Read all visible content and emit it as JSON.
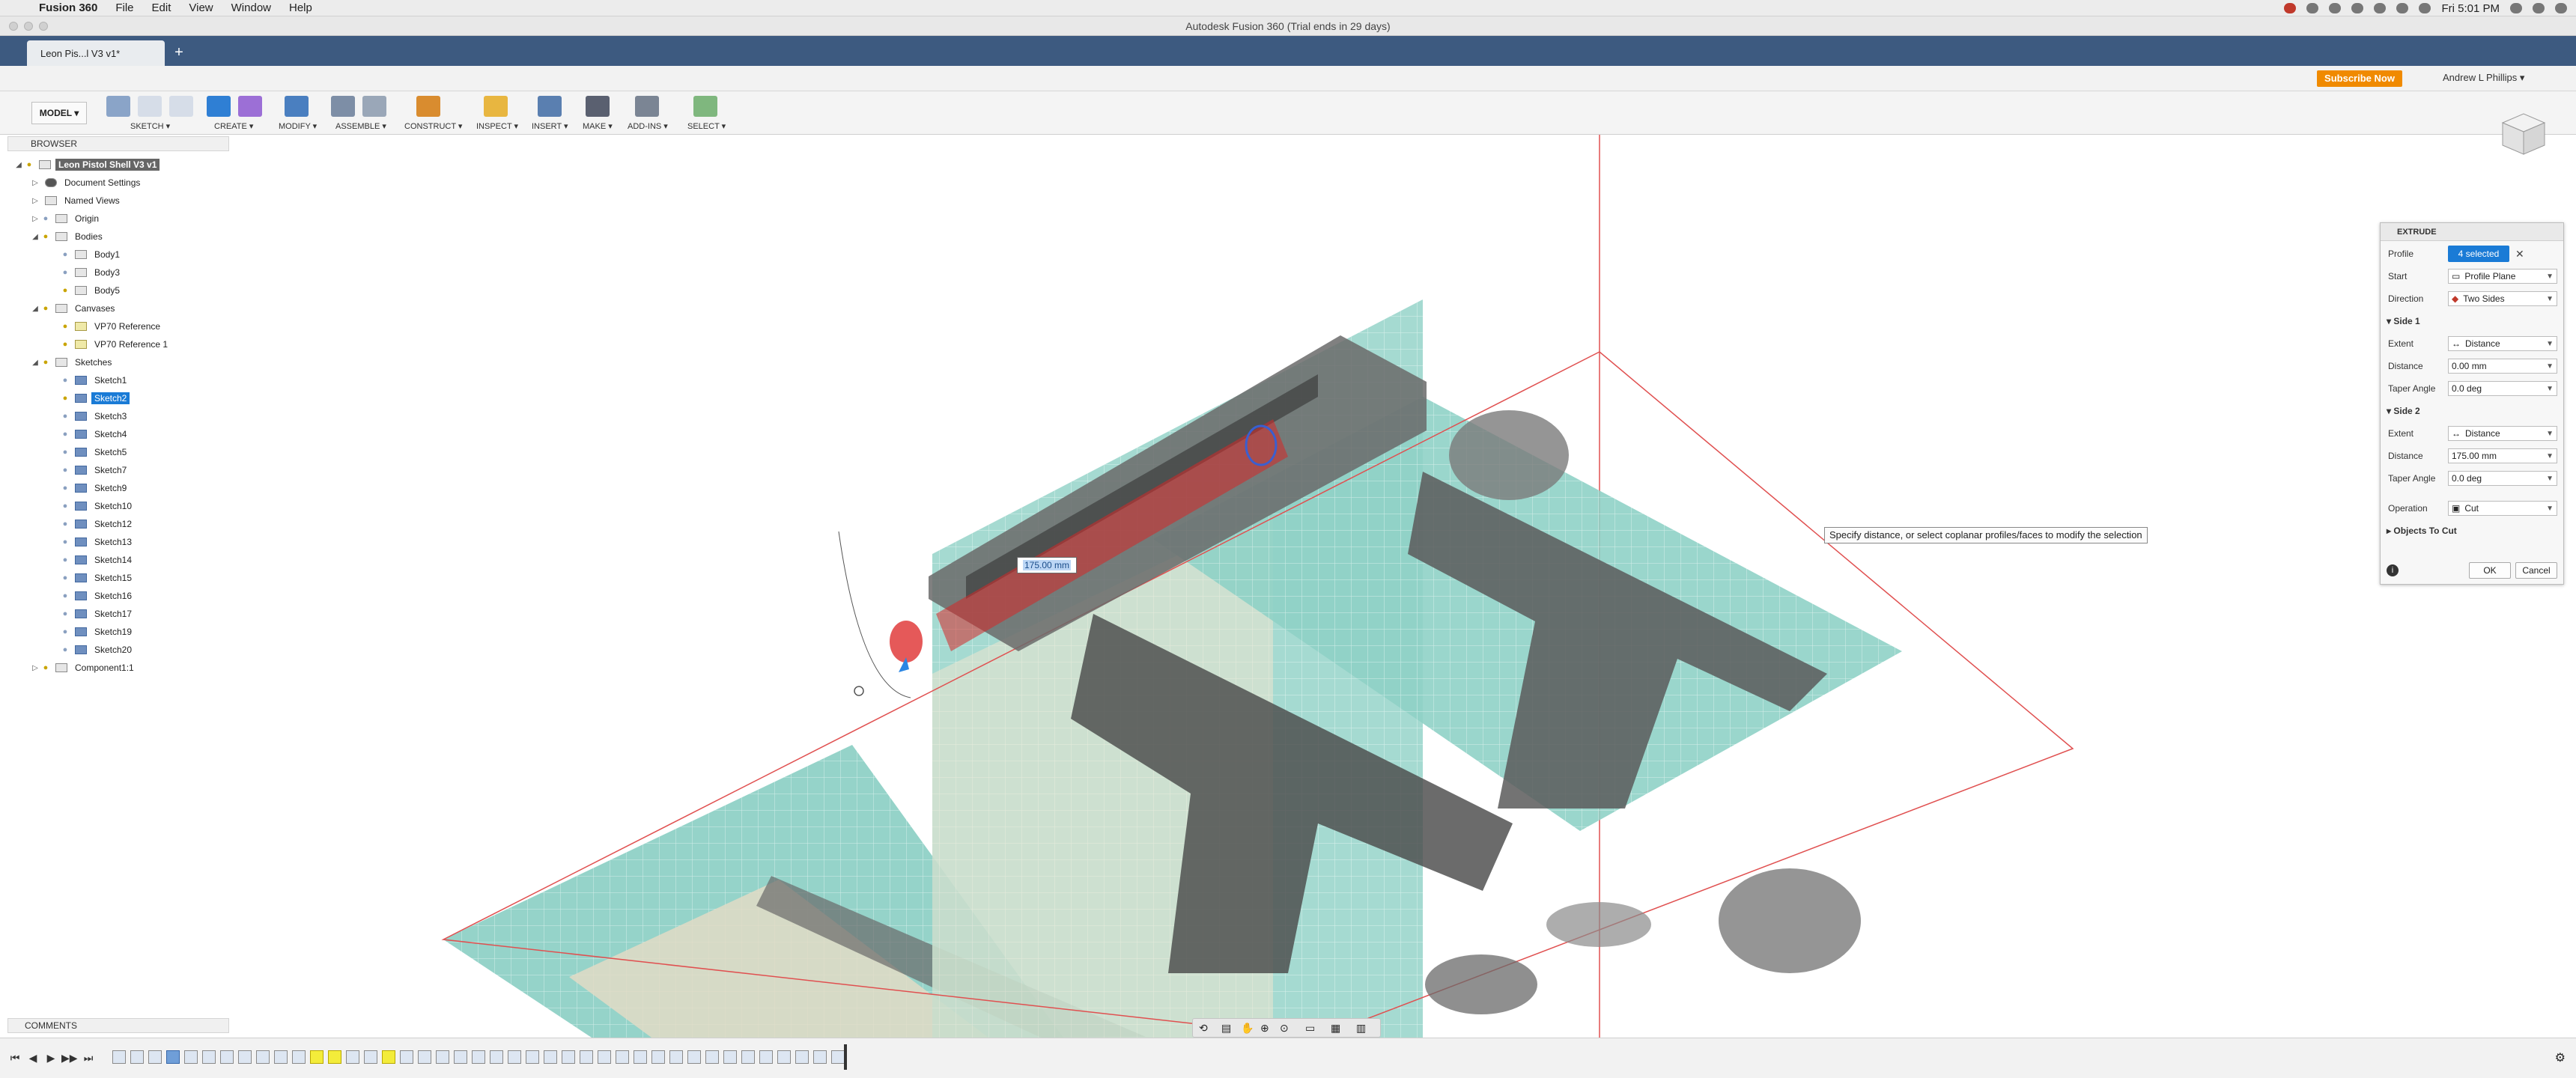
{
  "menubar": {
    "app_name": "Fusion 360",
    "items": [
      "File",
      "Edit",
      "View",
      "Window",
      "Help"
    ],
    "clock": "Fri 5:01 PM"
  },
  "window": {
    "title": "Autodesk Fusion 360 (Trial ends in 29 days)"
  },
  "tabs": [
    {
      "label": "Leon Pis...l V3 v1*"
    }
  ],
  "quickbar": {
    "subscribe_label": "Subscribe Now",
    "user_label": "Andrew L Phillips"
  },
  "ribbon": {
    "workspace_label": "MODEL",
    "groups": [
      "SKETCH",
      "CREATE",
      "MODIFY",
      "ASSEMBLE",
      "CONSTRUCT",
      "INSPECT",
      "INSERT",
      "MAKE",
      "ADD-INS",
      "SELECT"
    ]
  },
  "browser": {
    "title": "BROWSER",
    "root_label": "Leon Pistol Shell V3 v1",
    "items": [
      "Document Settings",
      "Named Views",
      "Origin",
      "Bodies",
      "Body1",
      "Body3",
      "Body5",
      "Canvases",
      "VP70 Reference",
      "VP70 Reference 1",
      "Sketches",
      "Sketch1",
      "Sketch2",
      "Sketch3",
      "Sketch4",
      "Sketch5",
      "Sketch7",
      "Sketch9",
      "Sketch10",
      "Sketch12",
      "Sketch13",
      "Sketch14",
      "Sketch15",
      "Sketch16",
      "Sketch17",
      "Sketch19",
      "Sketch20",
      "Component1:1"
    ]
  },
  "extrude": {
    "title": "EXTRUDE",
    "profile_label": "Profile",
    "profile_value": "4 selected",
    "start_label": "Start",
    "start_value": "Profile Plane",
    "direction_label": "Direction",
    "direction_value": "Two Sides",
    "side1_label": "Side 1",
    "side2_label": "Side 2",
    "extent_label": "Extent",
    "distance_label": "Distance",
    "taper_label": "Taper Angle",
    "side1_extent": "Distance",
    "side1_distance": "0.00 mm",
    "side1_taper": "0.0 deg",
    "side2_extent": "Distance",
    "side2_distance": "175.00 mm",
    "side2_taper": "0.0 deg",
    "operation_label": "Operation",
    "operation_value": "Cut",
    "objects_label": "Objects To Cut",
    "ok_label": "OK",
    "cancel_label": "Cancel"
  },
  "tooltip": "Specify distance, or select coplanar profiles/faces to modify the selection",
  "dimension_input": "175.00 mm",
  "comments": {
    "title": "COMMENTS"
  },
  "colors": {
    "accent": "#1a7bd6",
    "subscribe": "#f08a00",
    "tabbar": "#3d5a80",
    "canvas_grid": "#7fc9bd",
    "cut_preview": "#d62828"
  }
}
